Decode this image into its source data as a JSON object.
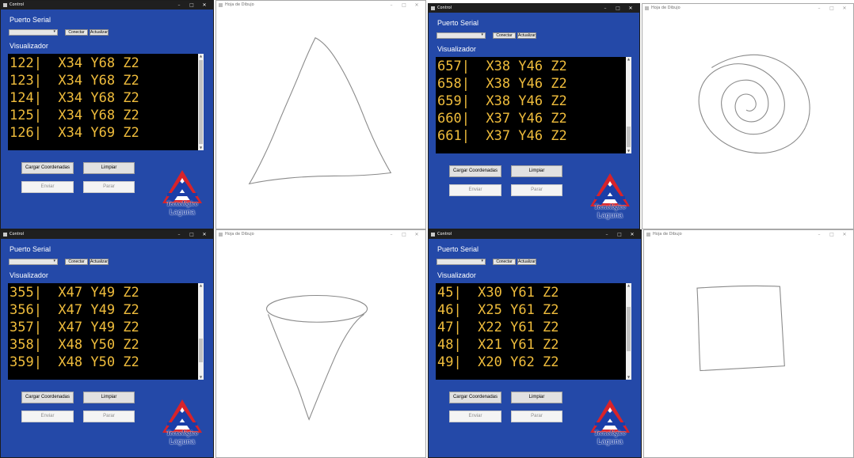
{
  "windows": {
    "control_title": "Control",
    "drawing_title": "Hoja de Dibujo"
  },
  "labels": {
    "puerto": "Puerto Serial",
    "visualizador": "Visualizador"
  },
  "buttons": {
    "conectar": "Conectar",
    "actualizar": "Actualizar",
    "cargar": "Cargar Coordenadas",
    "limpiar": "Limpiar",
    "enviar": "Enviar",
    "parar": "Parar"
  },
  "logo": {
    "script": "Tecnológico",
    "name": "Laguna"
  },
  "panels": [
    {
      "shape": "triangle",
      "lines": [
        "122|  X34 Y68 Z2",
        "123|  X34 Y68 Z2",
        "124|  X34 Y68 Z2",
        "125|  X34 Y68 Z2",
        "126|  X34 Y69 Z2"
      ]
    },
    {
      "shape": "spiral",
      "lines": [
        "657|  X38 Y46 Z2",
        "658|  X38 Y46 Z2",
        "659|  X38 Y46 Z2",
        "660|  X37 Y46 Z2",
        "661|  X37 Y46 Z2"
      ]
    },
    {
      "shape": "cone",
      "lines": [
        "355|  X47 Y49 Z2",
        "356|  X47 Y49 Z2",
        "357|  X47 Y49 Z2",
        "358|  X48 Y50 Z2",
        "359|  X48 Y50 Z2"
      ]
    },
    {
      "shape": "square",
      "lines": [
        "45|  X30 Y61 Z2",
        "46|  X25 Y61 Z2",
        "47|  X22 Y61 Z2",
        "48|  X21 Y61 Z2",
        "49|  X20 Y62 Z2"
      ]
    }
  ],
  "colors": {
    "panel_blue": "#2449a8",
    "console_text": "#f0bd3c",
    "console_bg": "#000000"
  }
}
